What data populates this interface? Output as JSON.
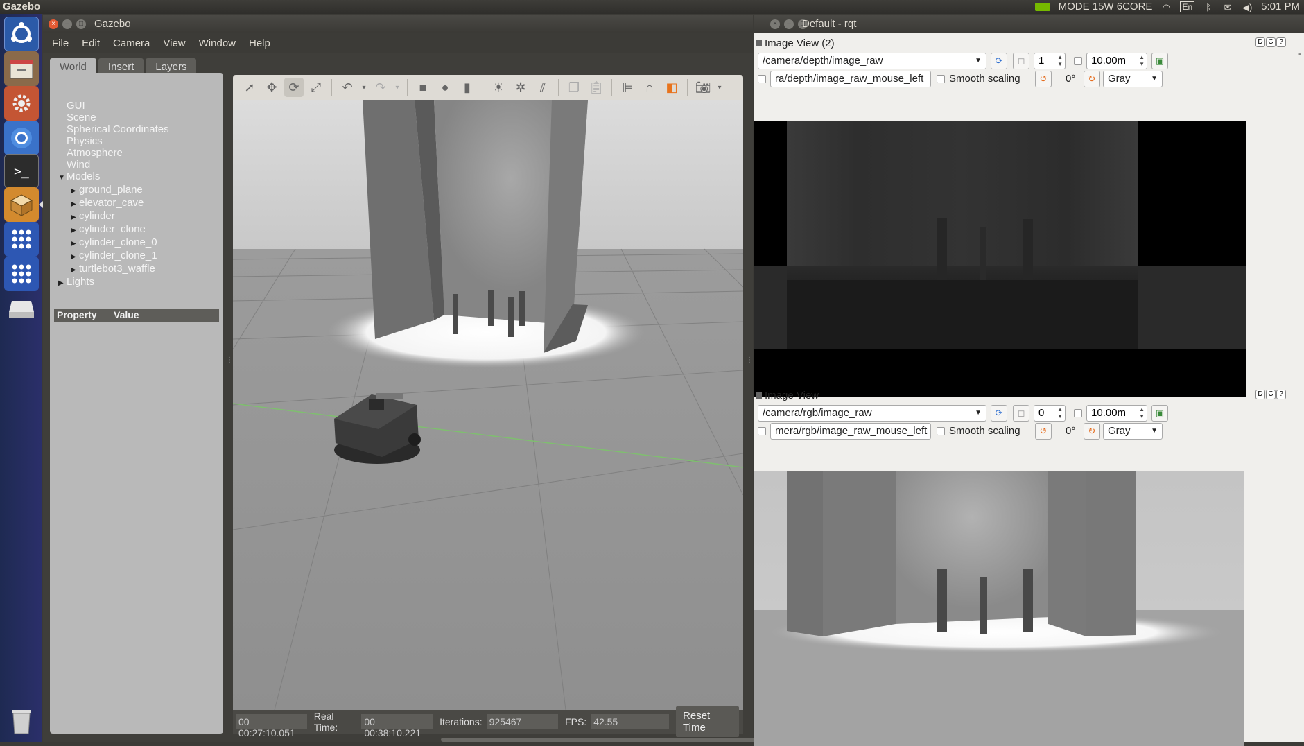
{
  "topbar": {
    "app_name": "Gazebo",
    "gpu_mode": "MODE 15W 6CORE",
    "lang": "En",
    "time": "5:01 PM",
    "icons": [
      "nvidia-icon",
      "wifi-icon",
      "keyboard-lang-icon",
      "bluetooth-icon",
      "mail-icon",
      "volume-icon"
    ]
  },
  "launcher": {
    "items": [
      "ubuntu-dash-icon",
      "files-icon",
      "settings-icon",
      "chromium-icon",
      "terminal-icon",
      "package-icon",
      "apps-grid-icon",
      "apps-grid-icon",
      "drive-icon",
      "trash-icon"
    ]
  },
  "gazebo": {
    "title": "Gazebo",
    "menu": [
      "File",
      "Edit",
      "Camera",
      "View",
      "Window",
      "Help"
    ],
    "tabs": [
      "World",
      "Insert",
      "Layers"
    ],
    "tree": {
      "top": [
        "GUI",
        "Scene",
        "Spherical Coordinates",
        "Physics",
        "Atmosphere",
        "Wind"
      ],
      "models_label": "Models",
      "models": [
        "ground_plane",
        "elevator_cave",
        "cylinder",
        "cylinder_clone",
        "cylinder_clone_0",
        "cylinder_clone_1",
        "turtlebot3_waffle"
      ],
      "lights_label": "Lights"
    },
    "property_header": {
      "property": "Property",
      "value": "Value"
    },
    "status": {
      "sim_time": "00 00:27:10.051",
      "real_time_label": "Real Time:",
      "real_time": "00 00:38:10.221",
      "iterations_label": "Iterations:",
      "iterations": "925467",
      "fps_label": "FPS:",
      "fps": "42.55",
      "reset_label": "Reset Time"
    }
  },
  "rqt": {
    "title": "Default - rqt",
    "panes": [
      {
        "title": "Image View (2)",
        "topic": "/camera/depth/image_raw",
        "spin_value": "1",
        "range": "10.00m",
        "mouse_topic": "ra/depth/image_raw_mouse_left",
        "smooth_label": "Smooth scaling",
        "rotation": "0°",
        "colormap": "Gray"
      },
      {
        "title": "Image View",
        "topic": "/camera/rgb/image_raw",
        "spin_value": "0",
        "range": "10.00m",
        "mouse_topic": "mera/rgb/image_raw_mouse_left",
        "smooth_label": "Smooth scaling",
        "rotation": "0°",
        "colormap": "Gray"
      }
    ],
    "dc_icons": [
      "D",
      "C",
      "?"
    ]
  }
}
